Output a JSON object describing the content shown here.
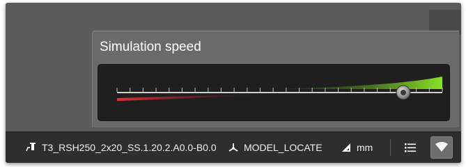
{
  "popup": {
    "title": "Simulation speed",
    "speed_slider": {
      "value_fraction": 0.88
    }
  },
  "statusbar": {
    "tool_name": "T3_RSH250_2x20_SS.1.20.2.A0.0-B0.0",
    "mode": "MODEL_LOCATE",
    "units": "mm"
  },
  "icons": {
    "tool": "robot-tool-icon",
    "mode": "coordinate-axes-icon",
    "units": "triangle-ruler-icon",
    "list": "list-icon",
    "wifi": "wifi-icon"
  },
  "colors": {
    "fast_gradient": "#7ed321",
    "slow_gradient": "#e0303a",
    "handle": "#8a8a8a"
  }
}
